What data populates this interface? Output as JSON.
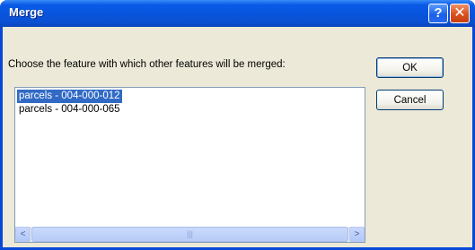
{
  "window": {
    "title": "Merge",
    "help_glyph": "?",
    "close_glyph": "✕"
  },
  "prompt": "Choose the feature with which other features will be merged:",
  "buttons": {
    "ok": "OK",
    "cancel": "Cancel"
  },
  "list": {
    "items": [
      {
        "label": "parcels - 004-000-012",
        "selected": true
      },
      {
        "label": "parcels - 004-000-065",
        "selected": false
      }
    ]
  },
  "scrollbar": {
    "left_arrow": "<",
    "right_arrow": ">",
    "grip": "|||"
  },
  "colors": {
    "title_bar": "#0854dc",
    "client_bg": "#ece9d8",
    "selection": "#316ac5"
  }
}
